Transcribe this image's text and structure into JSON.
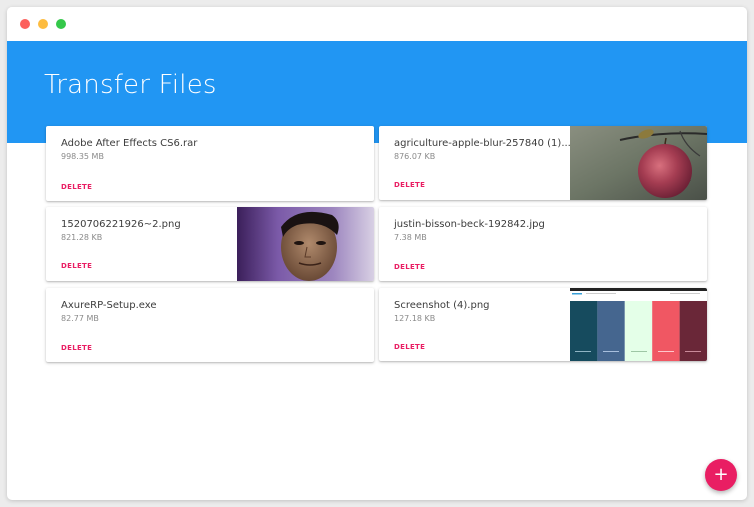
{
  "window": {
    "title": "Transfer Files"
  },
  "files": [
    {
      "name": "Adobe After Effects CS6.rar",
      "size": "998.35 MB",
      "action": "DELETE"
    },
    {
      "name": "agriculture-apple-blur-257840 (1)....",
      "size": "876.07 KB",
      "action": "DELETE"
    },
    {
      "name": "1520706221926~2.png",
      "size": "821.28 KB",
      "action": "DELETE"
    },
    {
      "name": "justin-bisson-beck-192842.jpg",
      "size": "7.38 MB",
      "action": "DELETE"
    },
    {
      "name": "AxureRP-Setup.exe",
      "size": "82.77 MB",
      "action": "DELETE"
    },
    {
      "name": "Screenshot (4).png",
      "size": "127.18 KB",
      "action": "DELETE"
    }
  ],
  "fab": {
    "label": "+"
  },
  "colors": {
    "header": "#2196f3",
    "accent": "#e91e63"
  }
}
